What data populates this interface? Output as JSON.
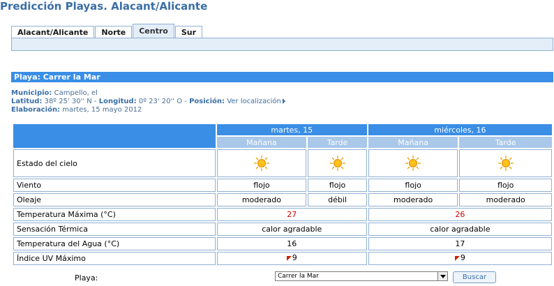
{
  "page_title": "Predicción Playas. Alacant/Alicante",
  "tabs": [
    {
      "label": "Alacant/Alicante",
      "active": false
    },
    {
      "label": "Norte",
      "active": false
    },
    {
      "label": "Centro",
      "active": true
    },
    {
      "label": "Sur",
      "active": false
    }
  ],
  "playa": {
    "header": "Playa:  Carrer la Mar",
    "municipio_label": "Municipio:",
    "municipio": "Campello, el",
    "latitud_label": "Latitud:",
    "latitud": "38º 25' 30'' N",
    "longitud_label": "Longitud:",
    "longitud": "0º 23' 20'' O",
    "posicion_label": "Posición:",
    "posicion_link": "Ver localización",
    "elaboracion_label": "Elaboración:",
    "elaboracion": "martes, 15 mayo 2012"
  },
  "forecast": {
    "days": [
      "martes, 15",
      "miércoles, 16"
    ],
    "periods": [
      "Mañana",
      "Tarde",
      "Mañana",
      "Tarde"
    ],
    "rows": {
      "cielo": {
        "label": "Estado del cielo",
        "icons": [
          "sun-icon",
          "sun-icon",
          "sun-icon",
          "sun-icon"
        ]
      },
      "viento": {
        "label": "Viento",
        "values": [
          "flojo",
          "flojo",
          "flojo",
          "flojo"
        ]
      },
      "oleaje": {
        "label": "Oleaje",
        "values": [
          "moderado",
          "débil",
          "moderado",
          "moderado"
        ]
      },
      "tmax": {
        "label": "Temperatura Máxima (°C)",
        "values": [
          "27",
          "26"
        ],
        "color": "#cc0000"
      },
      "sensacion": {
        "label": "Sensación Térmica",
        "values": [
          "calor agradable",
          "calor agradable"
        ]
      },
      "tagua": {
        "label": "Temperatura del Agua (°C)",
        "values": [
          "16",
          "17"
        ]
      },
      "uv": {
        "label": "Índice UV Máximo",
        "values": [
          "9",
          "9"
        ]
      }
    }
  },
  "footer": {
    "playa_label": "Playa:",
    "select_value": "Carrer la Mar",
    "button_label": "Buscar"
  },
  "colors": {
    "accent": "#3a8ee6",
    "title": "#3a6ea5",
    "period": "#a9c8ea",
    "temp": "#cc0000"
  }
}
